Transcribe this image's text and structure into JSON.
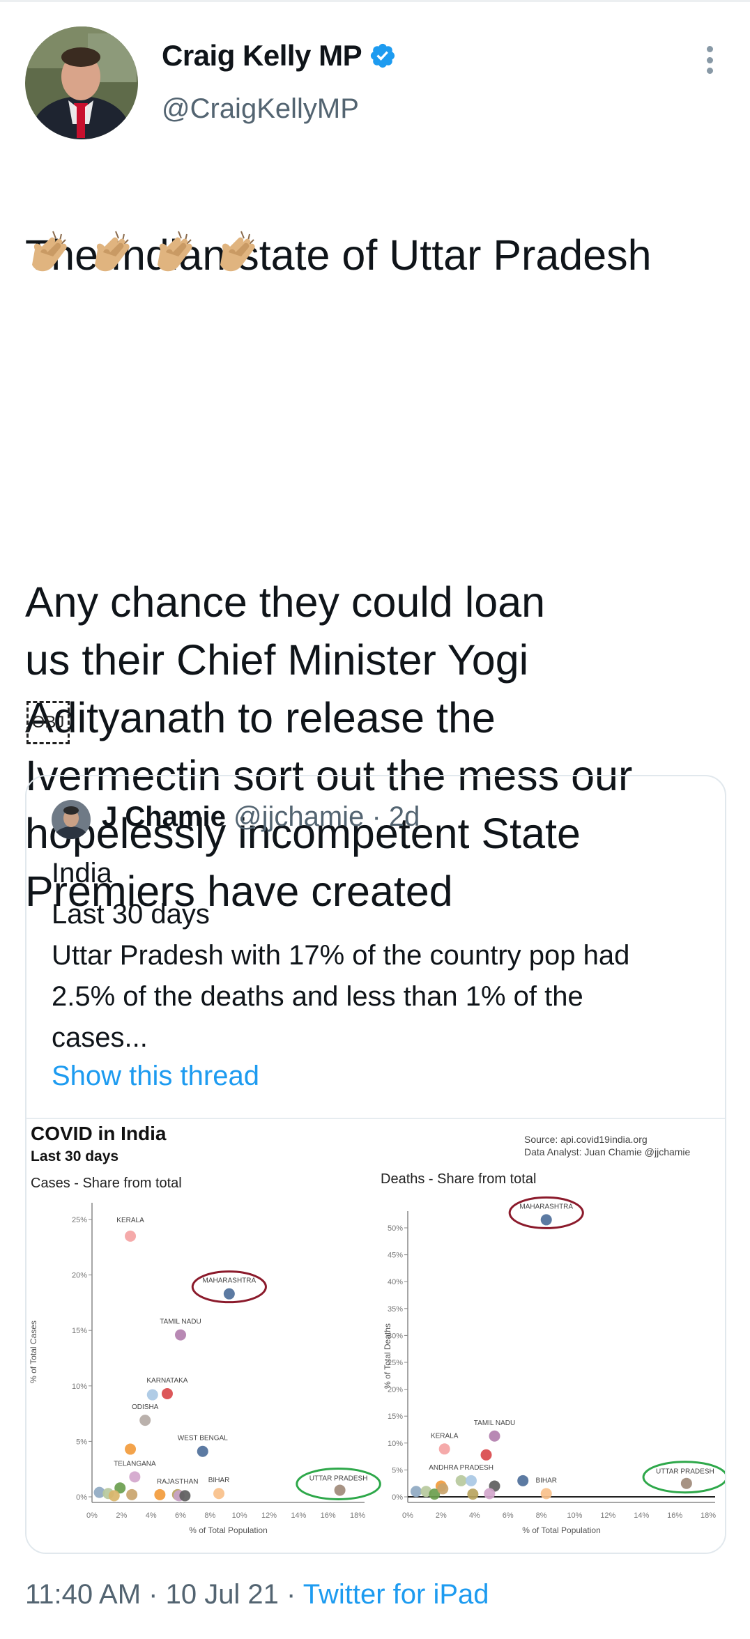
{
  "author": {
    "name": "Craig Kelly MP",
    "handle": "@CraigKellyMP"
  },
  "tweet": {
    "line1": "The Indian state of Uttar Pradesh",
    "emoji": [
      "👏",
      "👏",
      "👏",
      "👏"
    ],
    "body": "Any chance they could loan\nus their Chief Minister Yogi\nAdityanath to release the\nIvermectin sort out the mess our\nhopelessly incompetent  State\nPremiers have created",
    "obj_label": "OBJ"
  },
  "quoted": {
    "name": "J Chamie",
    "handle": "@jjchamie",
    "age": "· 2d",
    "lines": [
      "India",
      "Last 30 days",
      "Uttar Pradesh with 17% of the country pop had",
      "2.5% of the deaths and less than 1% of the",
      "cases..."
    ],
    "show_thread": "Show this thread"
  },
  "chart_data": [
    {
      "type": "scatter",
      "title": "COVID in India",
      "subtitle": "Last 30 days",
      "panel_title": "Cases - Share from total",
      "ylabel": "% of Total Cases",
      "xlabel": "% of Total Population",
      "xlim": [
        0,
        18
      ],
      "ylim": [
        0,
        25
      ],
      "xticks": [
        "0%",
        "2%",
        "4%",
        "6%",
        "8%",
        "10%",
        "12%",
        "14%",
        "16%",
        "18%"
      ],
      "yticks": [
        "0%",
        "5%",
        "10%",
        "15%",
        "20%",
        "25%"
      ],
      "points": [
        {
          "label": "KERALA",
          "x": 2.6,
          "y": 23.5,
          "color": "#f4a3a3"
        },
        {
          "label": "MAHARASHTRA",
          "x": 9.3,
          "y": 18.3,
          "color": "#4e6f9a",
          "circled": true
        },
        {
          "label": "TAMIL NADU",
          "x": 6.0,
          "y": 14.6,
          "color": "#b27fae"
        },
        {
          "label": "KARNATAKA",
          "x": 5.1,
          "y": 9.3,
          "color": "#d9494b"
        },
        {
          "label": "",
          "x": 4.1,
          "y": 9.2,
          "color": "#a9c8e4"
        },
        {
          "label": "ODISHA",
          "x": 3.6,
          "y": 6.9,
          "color": "#b4aaa5"
        },
        {
          "label": "",
          "x": 2.6,
          "y": 4.3,
          "color": "#f29b3c"
        },
        {
          "label": "WEST BENGAL",
          "x": 7.5,
          "y": 4.1,
          "color": "#4e6f9a"
        },
        {
          "label": "TELANGANA",
          "x": 2.9,
          "y": 1.8,
          "color": "#d3a6cc"
        },
        {
          "label": "",
          "x": 0.5,
          "y": 0.4,
          "color": "#8fa9c2"
        },
        {
          "label": "",
          "x": 1.1,
          "y": 0.3,
          "color": "#b7c99d"
        },
        {
          "label": "",
          "x": 1.9,
          "y": 0.8,
          "color": "#6a9e4e"
        },
        {
          "label": "",
          "x": 2.7,
          "y": 0.2,
          "color": "#c9a46d"
        },
        {
          "label": "",
          "x": 1.5,
          "y": 0.1,
          "color": "#d9b56a"
        },
        {
          "label": "RAJASTHAN",
          "x": 5.8,
          "y": 0.2,
          "color": "#b9a45e"
        },
        {
          "label": "",
          "x": 4.6,
          "y": 0.2,
          "color": "#f29b3c"
        },
        {
          "label": "",
          "x": 5.9,
          "y": 0.1,
          "color": "#c8a2c8"
        },
        {
          "label": "",
          "x": 6.3,
          "y": 0.1,
          "color": "#5e5e5e"
        },
        {
          "label": "BIHAR",
          "x": 8.6,
          "y": 0.3,
          "color": "#f8c08a"
        },
        {
          "label": "UTTAR PRADESH",
          "x": 16.8,
          "y": 0.6,
          "color": "#a08a7a",
          "circled": true
        }
      ]
    },
    {
      "type": "scatter",
      "title": "",
      "panel_title": "Deaths - Share from total",
      "source": "Source: api.covid19india.org",
      "analyst": "Data Analyst: Juan Chamie @jjchamie",
      "ylabel": "% of Total Deaths",
      "xlabel": "% of Total Population",
      "xlim": [
        0,
        18
      ],
      "ylim": [
        0,
        50
      ],
      "xticks": [
        "0%",
        "2%",
        "4%",
        "6%",
        "8%",
        "10%",
        "12%",
        "14%",
        "16%",
        "18%"
      ],
      "yticks": [
        "0%",
        "5%",
        "10%",
        "15%",
        "20%",
        "25%",
        "30%",
        "35%",
        "40%",
        "45%",
        "50%"
      ],
      "points": [
        {
          "label": "MAHARASHTRA",
          "x": 8.3,
          "y": 51.5,
          "color": "#4e6f9a",
          "circled": true
        },
        {
          "label": "TAMIL NADU",
          "x": 5.2,
          "y": 11.3,
          "color": "#b27fae"
        },
        {
          "label": "KERALA",
          "x": 2.2,
          "y": 8.9,
          "color": "#f4a3a3"
        },
        {
          "label": "",
          "x": 4.7,
          "y": 7.8,
          "color": "#d9494b"
        },
        {
          "label": "ANDHRA PRADESH",
          "x": 3.2,
          "y": 3.0,
          "color": "#b7c99d"
        },
        {
          "label": "",
          "x": 3.8,
          "y": 3.0,
          "color": "#a9c8e4"
        },
        {
          "label": "",
          "x": 2.0,
          "y": 2.0,
          "color": "#f29b3c"
        },
        {
          "label": "",
          "x": 6.9,
          "y": 3.0,
          "color": "#4e6f9a"
        },
        {
          "label": "",
          "x": 5.2,
          "y": 2.0,
          "color": "#5e5e5e"
        },
        {
          "label": "",
          "x": 0.5,
          "y": 1.0,
          "color": "#8fa9c2"
        },
        {
          "label": "",
          "x": 1.1,
          "y": 1.0,
          "color": "#b7c99d"
        },
        {
          "label": "",
          "x": 1.6,
          "y": 0.5,
          "color": "#6a9e4e"
        },
        {
          "label": "",
          "x": 2.1,
          "y": 1.5,
          "color": "#c9a46d"
        },
        {
          "label": "",
          "x": 3.9,
          "y": 0.5,
          "color": "#b9a45e"
        },
        {
          "label": "",
          "x": 4.9,
          "y": 0.6,
          "color": "#d3a6cc"
        },
        {
          "label": "BIHAR",
          "x": 8.3,
          "y": 0.6,
          "color": "#f8c08a"
        },
        {
          "label": "UTTAR PRADESH",
          "x": 16.7,
          "y": 2.5,
          "color": "#a08a7a",
          "circled": true
        }
      ]
    }
  ],
  "footer": {
    "time": "11:40 AM · 10 Jul 21 · ",
    "source": "Twitter for iPad"
  },
  "colors": {
    "accent": "#1d9bf0",
    "muted": "#536471",
    "maharashtra_ring": "#8b1a2b",
    "up_ring": "#2ea84a"
  }
}
